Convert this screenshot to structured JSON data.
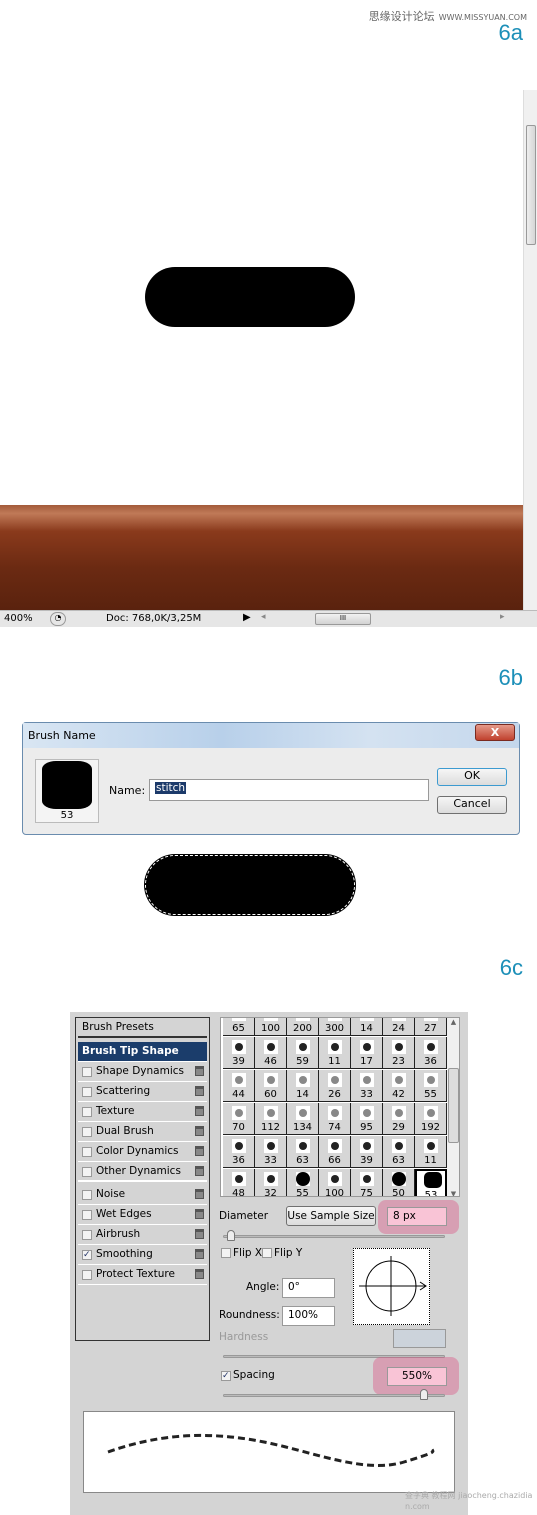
{
  "watermark": {
    "site_cn": "思缘设计论坛",
    "site_url": "WWW.MISSYUAN.COM",
    "footer": "查字典 教程网 jiaocheng.chazidian.com"
  },
  "steps": {
    "a": "6a",
    "b": "6b",
    "c": "6c"
  },
  "statusbar": {
    "zoom": "400%",
    "doc": "Doc: 768,0K/3,25M"
  },
  "dialog": {
    "title": "Brush Name",
    "close": "X",
    "preview_size": "53",
    "name_label": "Name:",
    "name_value": "stitch",
    "ok": "OK",
    "cancel": "Cancel"
  },
  "brushes": {
    "options": [
      {
        "label": "Brush Presets",
        "type": "header"
      },
      {
        "label": "Brush Tip Shape",
        "type": "selected"
      },
      {
        "label": "Shape Dynamics",
        "checked": false
      },
      {
        "label": "Scattering",
        "checked": false
      },
      {
        "label": "Texture",
        "checked": false
      },
      {
        "label": "Dual Brush",
        "checked": false
      },
      {
        "label": "Color Dynamics",
        "checked": false
      },
      {
        "label": "Other Dynamics",
        "checked": false
      },
      {
        "label": "Noise",
        "checked": false
      },
      {
        "label": "Wet Edges",
        "checked": false
      },
      {
        "label": "Airbrush",
        "checked": false
      },
      {
        "label": "Smoothing",
        "checked": true
      },
      {
        "label": "Protect Texture",
        "checked": false
      }
    ],
    "tips": [
      "65",
      "100",
      "200",
      "300",
      "14",
      "24",
      "27",
      "39",
      "46",
      "59",
      "11",
      "17",
      "23",
      "36",
      "44",
      "60",
      "14",
      "26",
      "33",
      "42",
      "55",
      "70",
      "112",
      "134",
      "74",
      "95",
      "29",
      "192",
      "36",
      "33",
      "63",
      "66",
      "39",
      "63",
      "11",
      "48",
      "32",
      "55",
      "100",
      "75",
      "50",
      "53"
    ],
    "selected_tip": "53",
    "diameter_label": "Diameter",
    "use_sample": "Use Sample Size",
    "diameter": "8 px",
    "flipx": "Flip X",
    "flipy": "Flip Y",
    "angle_label": "Angle:",
    "angle": "0°",
    "roundness_label": "Roundness:",
    "roundness": "100%",
    "hardness_label": "Hardness",
    "spacing_label": "Spacing",
    "spacing": "550%",
    "spacing_checked": true,
    "highlight_color": "#e892b0"
  }
}
